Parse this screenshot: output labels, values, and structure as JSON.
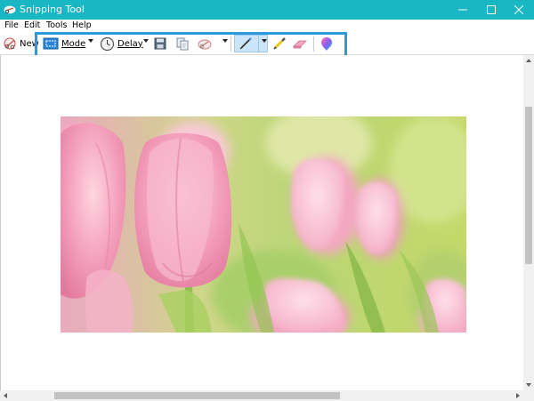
{
  "window": {
    "title": "Snipping Tool",
    "app_icon": "scissors-icon",
    "title_bar_color": "#19b6c4",
    "controls": [
      "minimize-icon",
      "maximize-icon",
      "close-icon"
    ]
  },
  "menu": {
    "items": [
      {
        "label": "File"
      },
      {
        "label": "Edit"
      },
      {
        "label": "Tools"
      },
      {
        "label": "Help"
      }
    ]
  },
  "toolbar": {
    "new_label": "New",
    "mode_label": "Mode",
    "delay_label": "Delay",
    "icons": {
      "new": "new-snip-icon",
      "mode": "mode-icon",
      "delay": "clock-icon",
      "save": "save-icon",
      "copy": "copy-icon",
      "send": "send-snip-icon",
      "pen": "pen-icon",
      "highlighter": "highlighter-icon",
      "eraser": "eraser-icon",
      "paint3d": "paint3d-icon"
    },
    "active_tool": "pen",
    "highlight_color": "#2a9bd8"
  },
  "canvas": {
    "image_subject": "pink tulips",
    "scroll": {
      "vertical_position": 0.26,
      "vertical_visible": 0.5,
      "horizontal_position": 0.2,
      "horizontal_visible": 0.57
    }
  }
}
